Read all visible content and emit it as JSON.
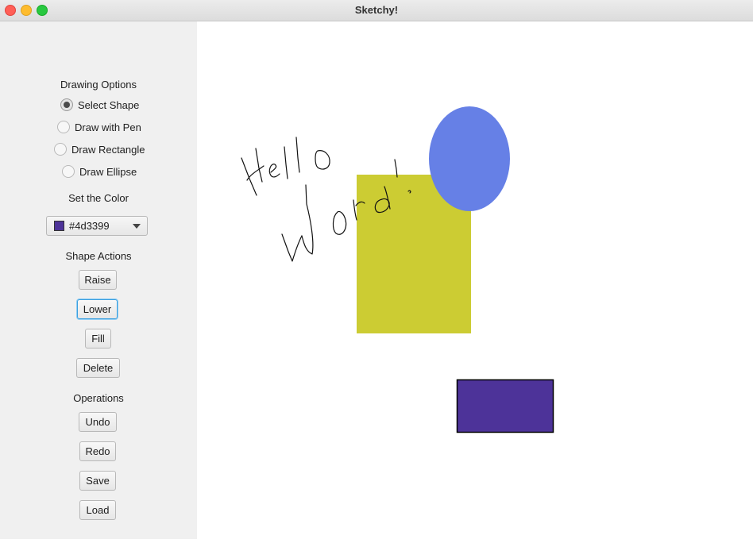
{
  "window": {
    "title": "Sketchy!"
  },
  "sidebar": {
    "drawing_options_label": "Drawing Options",
    "tools": [
      {
        "label": "Select Shape",
        "selected": true
      },
      {
        "label": "Draw with Pen",
        "selected": false
      },
      {
        "label": "Draw Rectangle",
        "selected": false
      },
      {
        "label": "Draw Ellipse",
        "selected": false
      }
    ],
    "color_label": "Set the Color",
    "color_value": "#4d3399",
    "shape_actions_label": "Shape Actions",
    "shape_actions": [
      "Raise",
      "Lower",
      "Fill",
      "Delete"
    ],
    "focused_action": "Lower",
    "operations_label": "Operations",
    "operations": [
      "Undo",
      "Redo",
      "Save",
      "Load"
    ]
  },
  "canvas": {
    "shapes": [
      {
        "kind": "rectangle",
        "fill": "#cccc33"
      },
      {
        "kind": "ellipse",
        "fill": "#6680e6"
      },
      {
        "kind": "rectangle",
        "fill": "#4d3399",
        "stroke": "#000000"
      },
      {
        "kind": "pen-stroke",
        "stroke": "#000000",
        "depicts": "handwritten scribble"
      }
    ]
  },
  "colors": {
    "sidebar_bg": "#f0f0f0",
    "canvas_bg": "#ffffff",
    "focus_ring": "#3a9fe0"
  }
}
